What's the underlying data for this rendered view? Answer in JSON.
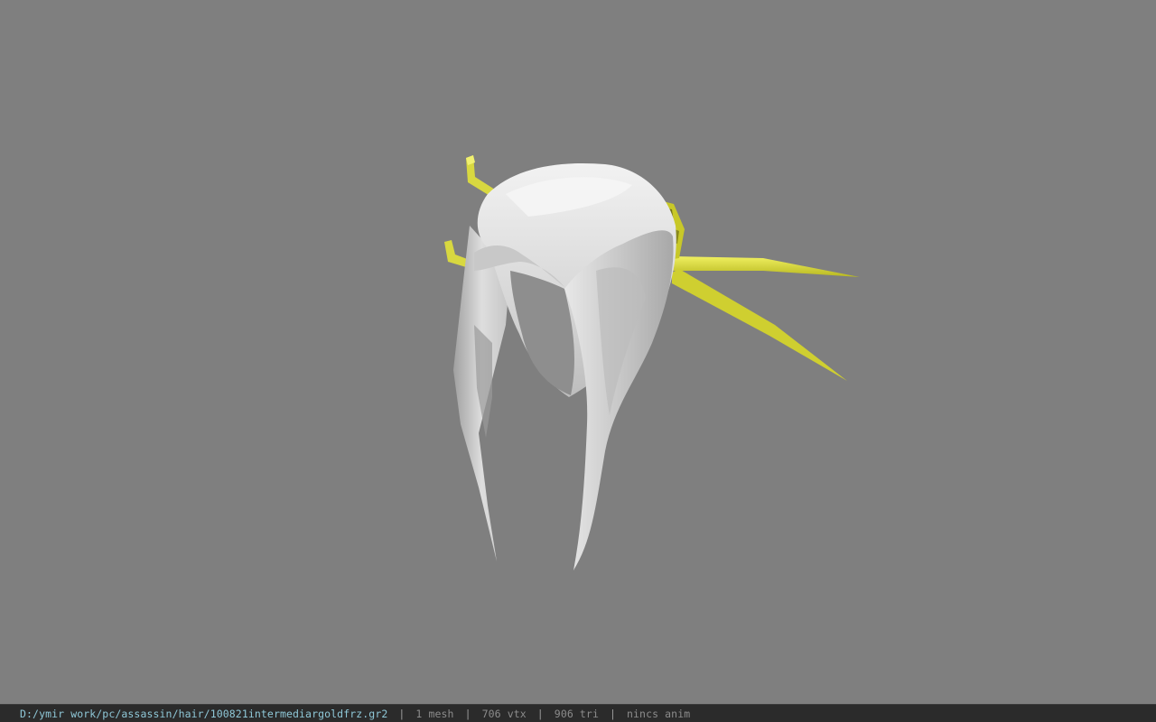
{
  "viewer": {
    "background_color": "#7f7f7f",
    "model_colors": {
      "hair": "#d9d9d9",
      "hair_shadow": "#9e9e9e",
      "ornament": "#e0e040"
    }
  },
  "status_bar": {
    "file_path": "D:/ymir work/pc/assassin/hair/100821intermediargoldfrz.gr2",
    "separator": "|",
    "mesh_count": "1 mesh",
    "vertex_count": "706 vtx",
    "triangle_count": "906 tri",
    "animation": "nincs anim"
  }
}
